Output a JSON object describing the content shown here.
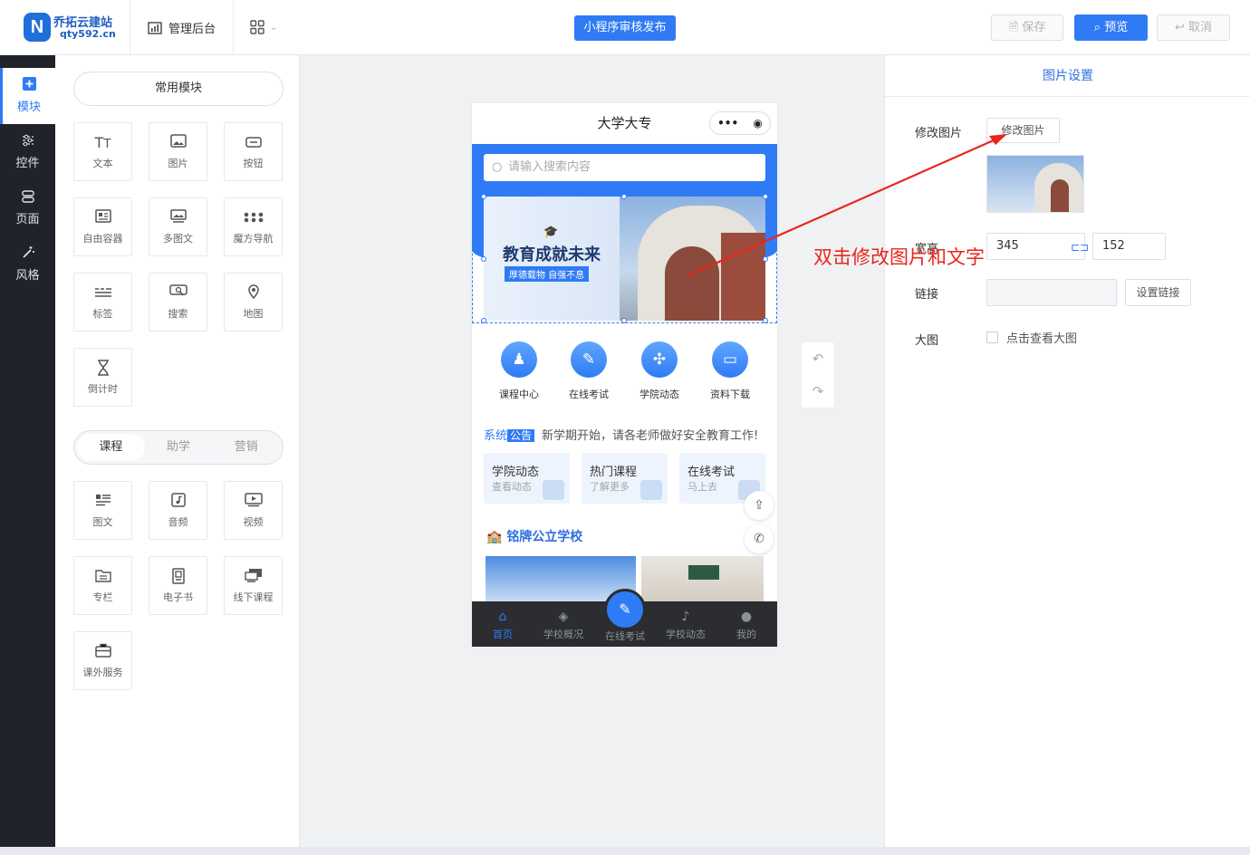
{
  "topbar": {
    "logo_mark": "N",
    "logo_name": "乔拓云建站",
    "logo_domain": "qty592.cn",
    "admin_label": "管理后台",
    "publish_label": "小程序审核发布",
    "save_label": "保存",
    "preview_label": "预览",
    "cancel_label": "取消"
  },
  "leftnav": {
    "items": [
      {
        "label": "模块",
        "icon": "plus-square-icon",
        "active": true
      },
      {
        "label": "控件",
        "icon": "sliders-icon"
      },
      {
        "label": "页面",
        "icon": "layers-icon"
      },
      {
        "label": "风格",
        "icon": "magic-wand-icon"
      }
    ]
  },
  "modules": {
    "common_label": "常用模块",
    "common": [
      {
        "label": "文本",
        "icon": "text-icon"
      },
      {
        "label": "图片",
        "icon": "image-icon"
      },
      {
        "label": "按钮",
        "icon": "button-icon"
      },
      {
        "label": "自由容器",
        "icon": "container-icon"
      },
      {
        "label": "多图文",
        "icon": "multi-image-icon"
      },
      {
        "label": "魔方导航",
        "icon": "grid-dots-icon"
      },
      {
        "label": "标签",
        "icon": "tag-icon"
      },
      {
        "label": "搜索",
        "icon": "search-box-icon"
      },
      {
        "label": "地图",
        "icon": "map-pin-icon"
      },
      {
        "label": "倒计时",
        "icon": "hourglass-icon"
      }
    ],
    "tabs": [
      "课程",
      "助学",
      "营销"
    ],
    "course": [
      {
        "label": "图文",
        "icon": "article-icon"
      },
      {
        "label": "音频",
        "icon": "audio-icon"
      },
      {
        "label": "视频",
        "icon": "video-icon"
      },
      {
        "label": "专栏",
        "icon": "column-icon"
      },
      {
        "label": "电子书",
        "icon": "ebook-icon"
      },
      {
        "label": "线下课程",
        "icon": "offline-course-icon"
      },
      {
        "label": "课外服务",
        "icon": "briefcase-icon"
      }
    ]
  },
  "phone": {
    "title": "大学大专",
    "search_placeholder": "请输入搜索内容",
    "banner_title": "教育成就未来",
    "banner_subtitle": "厚德载物 自强不息",
    "shortcuts": [
      "课程中心",
      "在线考试",
      "学院动态",
      "资料下载"
    ],
    "notice_sys": "系统",
    "notice_tag": "公告",
    "notice_text": "新学期开始，请各老师做好安全教育工作!",
    "cards": [
      {
        "title": "学院动态",
        "sub": "查看动态"
      },
      {
        "title": "热门课程",
        "sub": "了解更多"
      },
      {
        "title": "在线考试",
        "sub": "马上去"
      }
    ],
    "section_title": "铭牌公立学校",
    "tabbar": [
      "首页",
      "学校概况",
      "在线考试",
      "学校动态",
      "我的"
    ]
  },
  "settings": {
    "title": "图片设置",
    "modify_label": "修改图片",
    "modify_button": "修改图片",
    "size_label": "宽高",
    "width": "345",
    "height": "152",
    "link_label": "链接",
    "link_value": "",
    "set_link_button": "设置链接",
    "bigimg_label": "大图",
    "bigimg_checkbox": "点击查看大图"
  },
  "annotation": {
    "text": "双击修改图片和文字",
    "color": "#e8261c"
  },
  "colors": {
    "accent": "#2f7bf5",
    "sidebar": "#20232a"
  }
}
